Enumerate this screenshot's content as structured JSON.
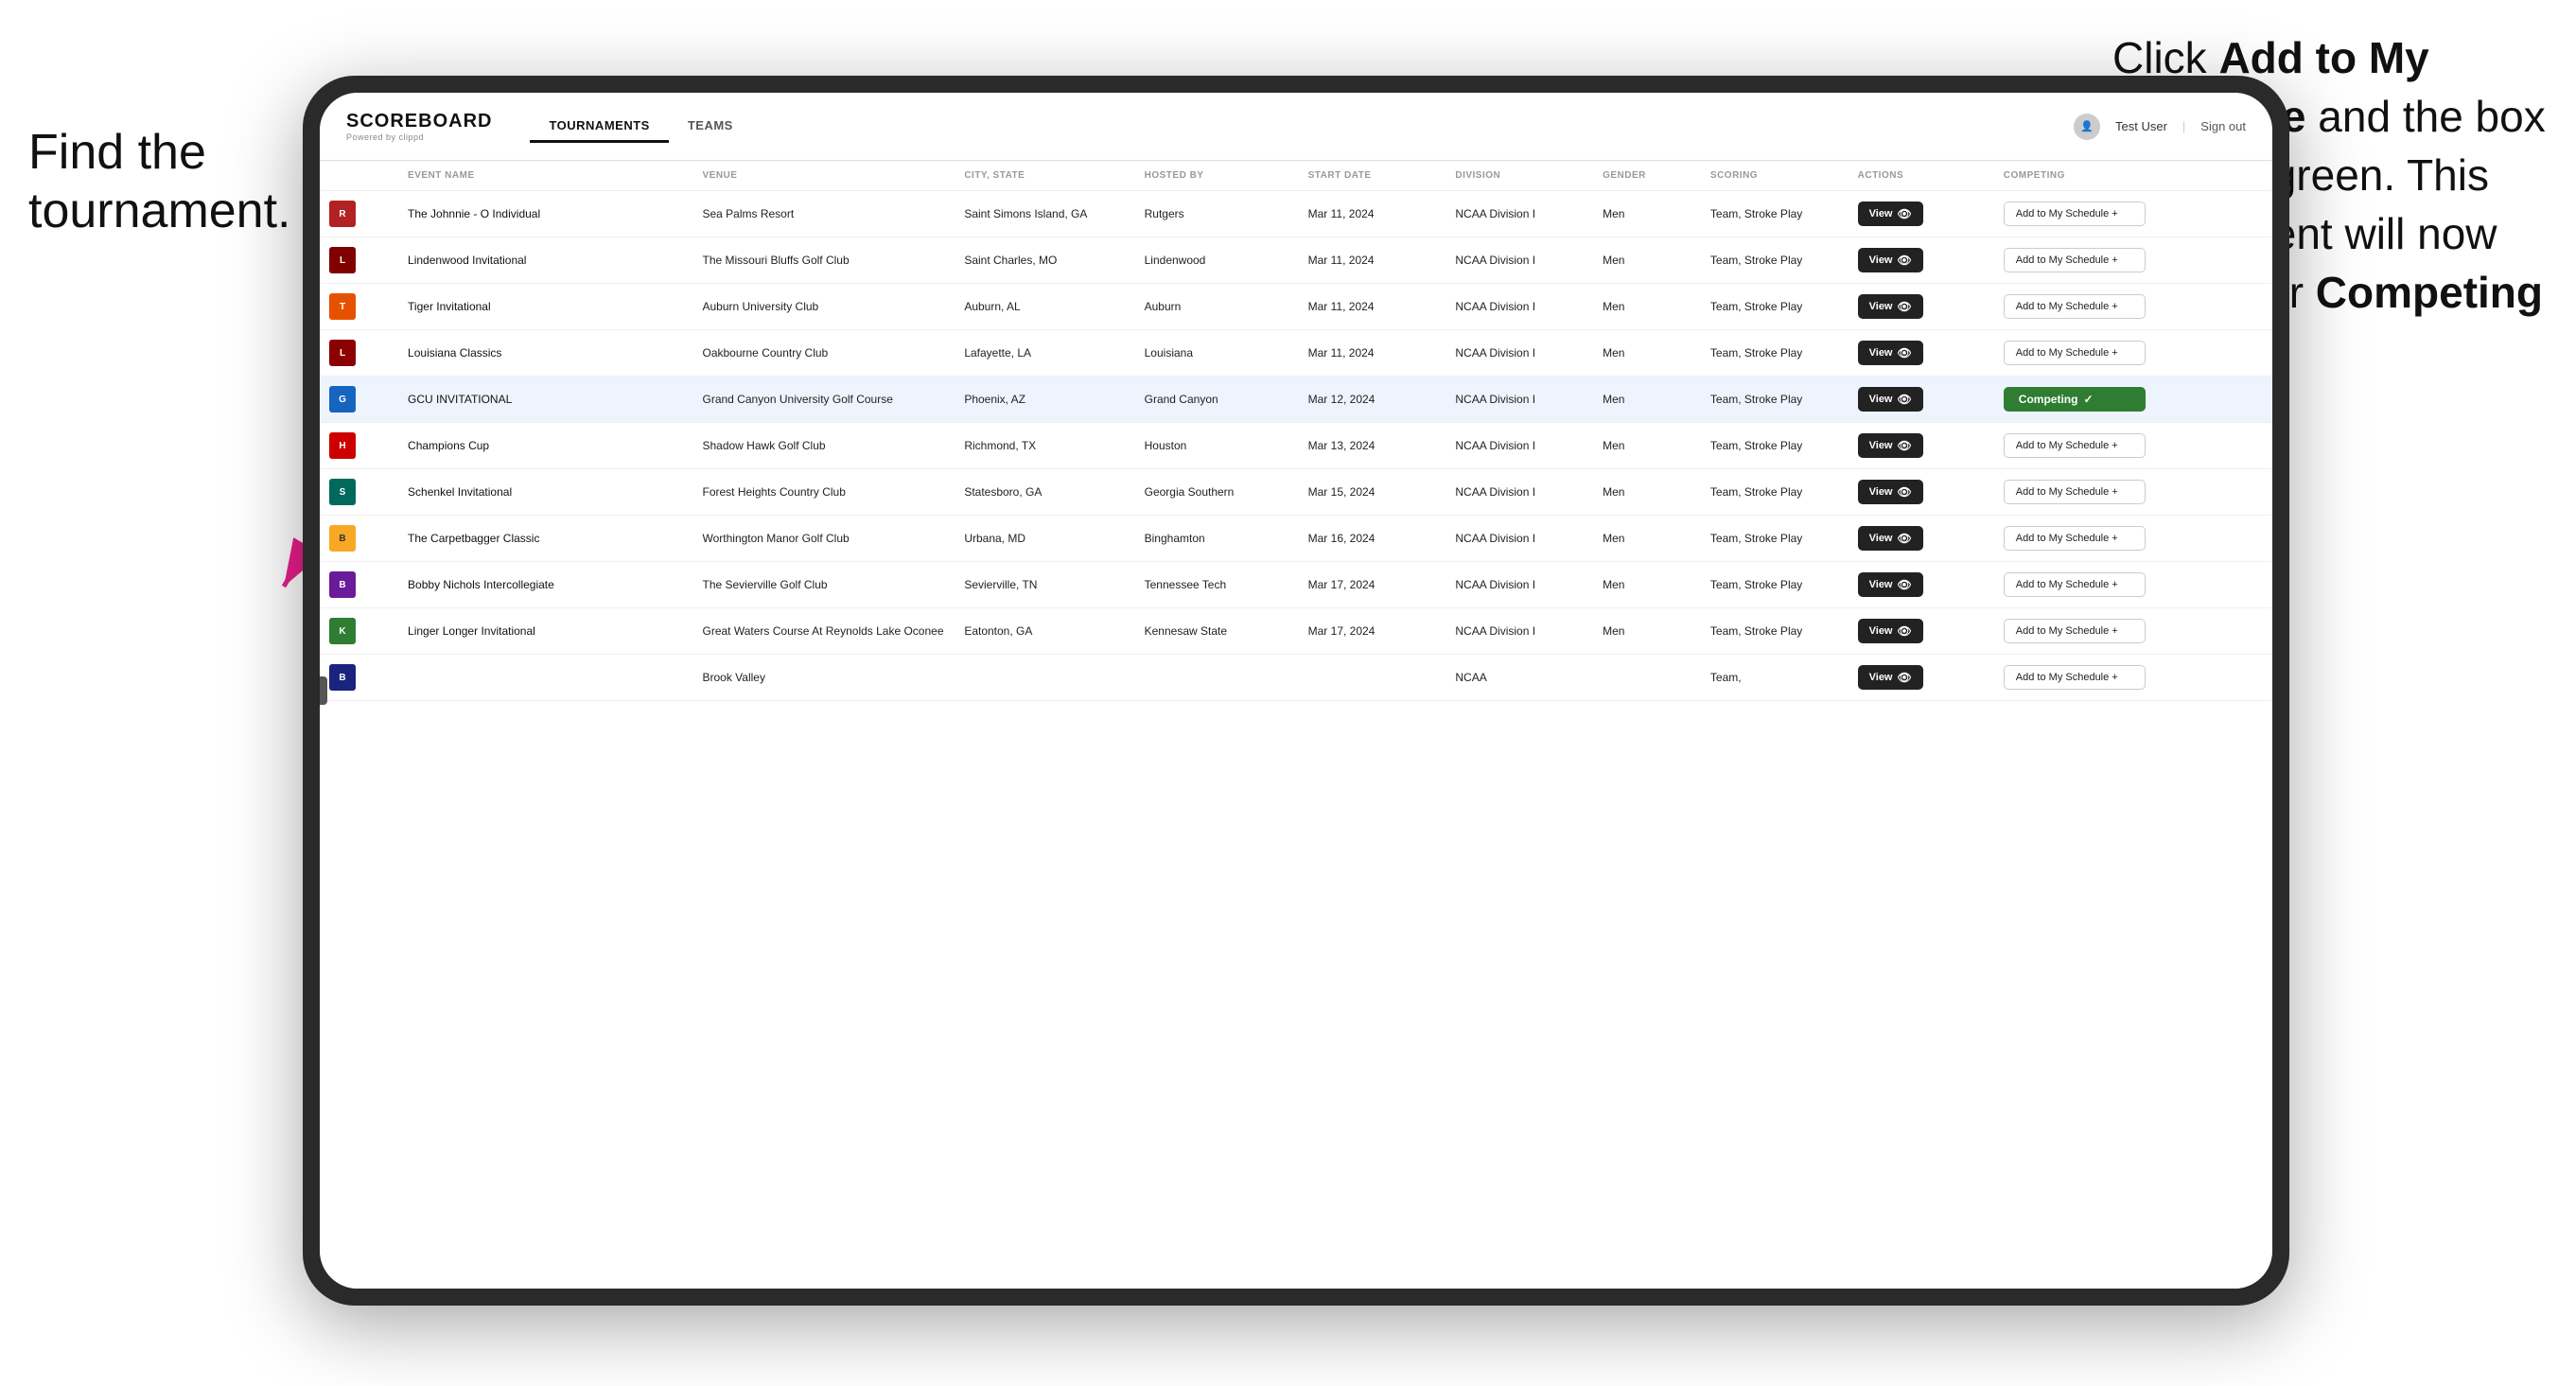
{
  "annotations": {
    "left_title": "Find the tournament.",
    "right_title": "Click Add to My Schedule and the box will turn green. This tournament will now be in your Competing section."
  },
  "header": {
    "logo": "SCOREBOARD",
    "logo_sub": "Powered by clippd",
    "nav": [
      {
        "label": "TOURNAMENTS",
        "active": true
      },
      {
        "label": "TEAMS",
        "active": false
      }
    ],
    "user": "Test User",
    "sign_out": "Sign out"
  },
  "table": {
    "columns": [
      {
        "label": "",
        "key": "logo"
      },
      {
        "label": "EVENT NAME",
        "key": "event_name"
      },
      {
        "label": "VENUE",
        "key": "venue"
      },
      {
        "label": "CITY, STATE",
        "key": "city_state"
      },
      {
        "label": "HOSTED BY",
        "key": "hosted_by"
      },
      {
        "label": "START DATE",
        "key": "start_date"
      },
      {
        "label": "DIVISION",
        "key": "division"
      },
      {
        "label": "GENDER",
        "key": "gender"
      },
      {
        "label": "SCORING",
        "key": "scoring"
      },
      {
        "label": "ACTIONS",
        "key": "actions"
      },
      {
        "label": "COMPETING",
        "key": "competing"
      }
    ],
    "rows": [
      {
        "id": 1,
        "logo_text": "R",
        "logo_class": "logo-red",
        "event_name": "The Johnnie - O Individual",
        "venue": "Sea Palms Resort",
        "city_state": "Saint Simons Island, GA",
        "hosted_by": "Rutgers",
        "start_date": "Mar 11, 2024",
        "division": "NCAA Division I",
        "gender": "Men",
        "scoring": "Team, Stroke Play",
        "view_label": "View",
        "action_label": "Add to My Schedule +",
        "status": "add",
        "highlighted": false
      },
      {
        "id": 2,
        "logo_text": "L",
        "logo_class": "logo-maroon",
        "event_name": "Lindenwood Invitational",
        "venue": "The Missouri Bluffs Golf Club",
        "city_state": "Saint Charles, MO",
        "hosted_by": "Lindenwood",
        "start_date": "Mar 11, 2024",
        "division": "NCAA Division I",
        "gender": "Men",
        "scoring": "Team, Stroke Play",
        "view_label": "View",
        "action_label": "Add to My Schedule +",
        "status": "add",
        "highlighted": false
      },
      {
        "id": 3,
        "logo_text": "T",
        "logo_class": "logo-orange",
        "event_name": "Tiger Invitational",
        "venue": "Auburn University Club",
        "city_state": "Auburn, AL",
        "hosted_by": "Auburn",
        "start_date": "Mar 11, 2024",
        "division": "NCAA Division I",
        "gender": "Men",
        "scoring": "Team, Stroke Play",
        "view_label": "View",
        "action_label": "Add to My Schedule +",
        "status": "add",
        "highlighted": false
      },
      {
        "id": 4,
        "logo_text": "L",
        "logo_class": "logo-darkred",
        "event_name": "Louisiana Classics",
        "venue": "Oakbourne Country Club",
        "city_state": "Lafayette, LA",
        "hosted_by": "Louisiana",
        "start_date": "Mar 11, 2024",
        "division": "NCAA Division I",
        "gender": "Men",
        "scoring": "Team, Stroke Play",
        "view_label": "View",
        "action_label": "Add to My Schedule +",
        "status": "add",
        "highlighted": false
      },
      {
        "id": 5,
        "logo_text": "G",
        "logo_class": "logo-blue",
        "event_name": "GCU INVITATIONAL",
        "venue": "Grand Canyon University Golf Course",
        "city_state": "Phoenix, AZ",
        "hosted_by": "Grand Canyon",
        "start_date": "Mar 12, 2024",
        "division": "NCAA Division I",
        "gender": "Men",
        "scoring": "Team, Stroke Play",
        "view_label": "View",
        "action_label": "Competing ✓",
        "status": "competing",
        "highlighted": true
      },
      {
        "id": 6,
        "logo_text": "H",
        "logo_class": "logo-scarlet",
        "event_name": "Champions Cup",
        "venue": "Shadow Hawk Golf Club",
        "city_state": "Richmond, TX",
        "hosted_by": "Houston",
        "start_date": "Mar 13, 2024",
        "division": "NCAA Division I",
        "gender": "Men",
        "scoring": "Team, Stroke Play",
        "view_label": "View",
        "action_label": "Add to My Schedule +",
        "status": "add",
        "highlighted": false
      },
      {
        "id": 7,
        "logo_text": "S",
        "logo_class": "logo-teal",
        "event_name": "Schenkel Invitational",
        "venue": "Forest Heights Country Club",
        "city_state": "Statesboro, GA",
        "hosted_by": "Georgia Southern",
        "start_date": "Mar 15, 2024",
        "division": "NCAA Division I",
        "gender": "Men",
        "scoring": "Team, Stroke Play",
        "view_label": "View",
        "action_label": "Add to My Schedule +",
        "status": "add",
        "highlighted": false
      },
      {
        "id": 8,
        "logo_text": "B",
        "logo_class": "logo-gold",
        "event_name": "The Carpetbagger Classic",
        "venue": "Worthington Manor Golf Club",
        "city_state": "Urbana, MD",
        "hosted_by": "Binghamton",
        "start_date": "Mar 16, 2024",
        "division": "NCAA Division I",
        "gender": "Men",
        "scoring": "Team, Stroke Play",
        "view_label": "View",
        "action_label": "Add to My Schedule +",
        "status": "add",
        "highlighted": false
      },
      {
        "id": 9,
        "logo_text": "B",
        "logo_class": "logo-purple",
        "event_name": "Bobby Nichols Intercollegiate",
        "venue": "The Sevierville Golf Club",
        "city_state": "Sevierville, TN",
        "hosted_by": "Tennessee Tech",
        "start_date": "Mar 17, 2024",
        "division": "NCAA Division I",
        "gender": "Men",
        "scoring": "Team, Stroke Play",
        "view_label": "View",
        "action_label": "Add to My Schedule +",
        "status": "add",
        "highlighted": false
      },
      {
        "id": 10,
        "logo_text": "K",
        "logo_class": "logo-green",
        "event_name": "Linger Longer Invitational",
        "venue": "Great Waters Course At Reynolds Lake Oconee",
        "city_state": "Eatonton, GA",
        "hosted_by": "Kennesaw State",
        "start_date": "Mar 17, 2024",
        "division": "NCAA Division I",
        "gender": "Men",
        "scoring": "Team, Stroke Play",
        "view_label": "View",
        "action_label": "Add to My Schedule +",
        "status": "add",
        "highlighted": false
      },
      {
        "id": 11,
        "logo_text": "B",
        "logo_class": "logo-navy",
        "event_name": "",
        "venue": "Brook Valley",
        "city_state": "",
        "hosted_by": "",
        "start_date": "",
        "division": "NCAA",
        "gender": "",
        "scoring": "Team,",
        "view_label": "View",
        "action_label": "Add to My Schedule +",
        "status": "add",
        "highlighted": false
      }
    ]
  }
}
